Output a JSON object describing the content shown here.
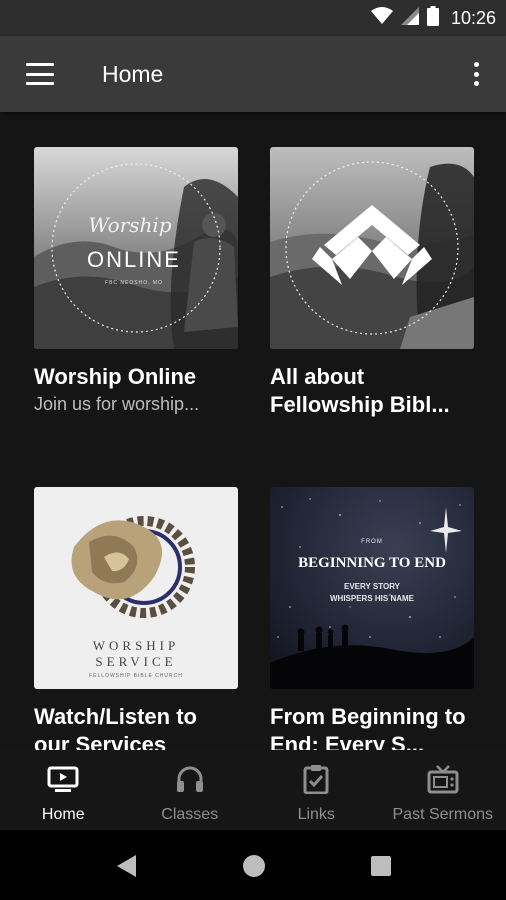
{
  "status_bar": {
    "time": "10:26"
  },
  "app_bar": {
    "title": "Home"
  },
  "cards": [
    {
      "title": "Worship Online",
      "subtitle": "Join us for worship...",
      "image_text": {
        "line1": "Worship",
        "line2": "ONLINE",
        "line3": "FBC NEOSHO, MO"
      }
    },
    {
      "title": "All about Fellowship Bibl...",
      "subtitle": ""
    },
    {
      "title": "Watch/Listen to our Services",
      "subtitle": "",
      "image_text": {
        "line1": "WORSHIP",
        "line2": "SERVICE",
        "line3": "FELLOWSHIP BIBLE CHURCH"
      }
    },
    {
      "title": "From Beginning to End: Every S...",
      "subtitle": "",
      "image_text": {
        "line1": "FROM",
        "line2": "BEGINNING TO END",
        "line3": "EVERY STORY",
        "line4": "WHISPERS HIS NAME"
      }
    }
  ],
  "bottom_nav": [
    {
      "label": "Home",
      "icon": "tv-play-icon",
      "active": true
    },
    {
      "label": "Classes",
      "icon": "headphones-icon",
      "active": false
    },
    {
      "label": "Links",
      "icon": "clipboard-check-icon",
      "active": false
    },
    {
      "label": "Past Sermons",
      "icon": "tv-icon",
      "active": false
    }
  ],
  "colors": {
    "app_bar": "#3a3a3a",
    "background": "#151515",
    "active": "#ffffff",
    "inactive": "#8e8e8e"
  }
}
